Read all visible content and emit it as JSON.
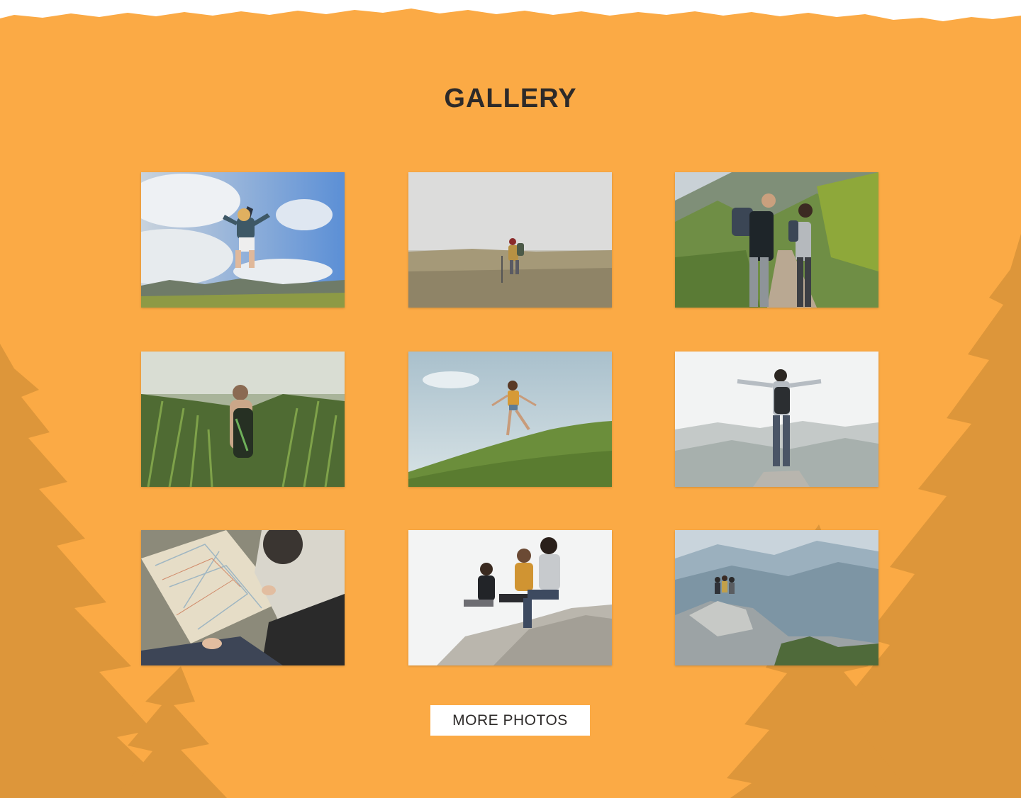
{
  "gallery": {
    "title": "GALLERY",
    "photos": [
      {
        "icon": "photo-jumping-hiker"
      },
      {
        "icon": "photo-walking-field"
      },
      {
        "icon": "photo-hikers-trail"
      },
      {
        "icon": "photo-hiker-grass"
      },
      {
        "icon": "photo-hill-walk"
      },
      {
        "icon": "photo-summit-arms"
      },
      {
        "icon": "photo-reading-map"
      },
      {
        "icon": "photo-friends-rock"
      },
      {
        "icon": "photo-mountain-view"
      }
    ],
    "more_label": "MORE PHOTOS"
  },
  "colors": {
    "background": "#fbaa45",
    "trees": "#dd963a",
    "title": "#2d2a29",
    "button_bg": "#ffffff"
  }
}
